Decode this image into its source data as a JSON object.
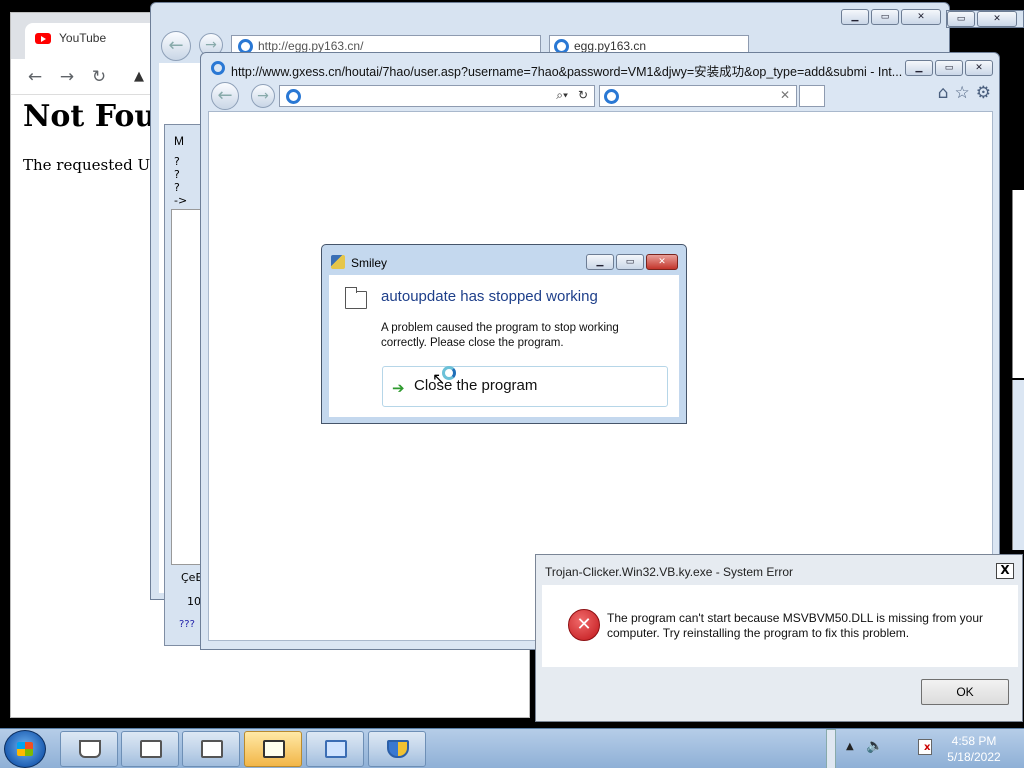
{
  "chrome": {
    "tab_title": "YouTube",
    "page_heading": "Not Foun",
    "page_text": "The requested URL"
  },
  "ie_back": {
    "address": "http://egg.py163.cn/",
    "tab_title": "egg.py163.cn"
  },
  "m_dialog": {
    "title": "M",
    "lines": [
      "?",
      "?",
      "?",
      "->"
    ],
    "footer_label": "ÇeE",
    "footer_value": "10",
    "footer_extra": "???"
  },
  "ie_main": {
    "title": "http://www.gxess.cn/houtai/7hao/user.asp?username=7hao&password=VM1&djwy=安装成功&op_type=add&submi - Int..."
  },
  "smiley": {
    "title": "Smiley",
    "heading": "autoupdate has stopped working",
    "message": "A problem caused the program to stop working correctly. Please close the program.",
    "button_label": "Close the program"
  },
  "system_error": {
    "title": "Trojan-Clicker.Win32.VB.ky.exe - System Error",
    "message": "The program can't start because MSVBVM50.DLL is missing from your computer. Try reinstalling the program to fix this problem.",
    "ok_label": "OK",
    "close_label": "X"
  },
  "taskbar": {
    "time": "4:58 PM",
    "date": "5/18/2022"
  },
  "icons": {
    "yt": "youtube-icon",
    "ie": "ie-e-icon",
    "error": "error-x-icon",
    "folder": "folder-icon"
  },
  "colors": {
    "error_red": "#c0161a",
    "heading_blue": "#1e3f8a",
    "taskbar": "#8fb0d6"
  }
}
